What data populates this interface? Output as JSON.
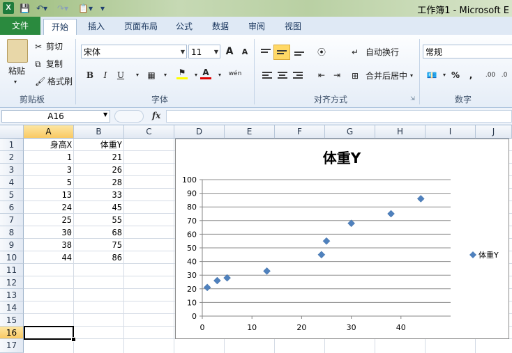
{
  "titlebar": {
    "window_title": "工作簿1 - Microsoft E",
    "app_icon": "X"
  },
  "tabs": {
    "file": "文件",
    "home": "开始",
    "insert": "插入",
    "page_layout": "页面布局",
    "formulas": "公式",
    "data": "数据",
    "review": "审阅",
    "view": "视图"
  },
  "ribbon": {
    "clipboard": {
      "label": "剪贴板",
      "paste": "粘贴",
      "cut": "剪切",
      "copy": "复制",
      "format_painter": "格式刷"
    },
    "font": {
      "label": "字体",
      "font_name": "宋体",
      "font_size": "11",
      "grow": "A",
      "shrink": "A",
      "bold": "B",
      "italic": "I",
      "underline": "U",
      "phonetic": "wén"
    },
    "alignment": {
      "label": "对齐方式",
      "wrap_text": "自动换行",
      "merge_center": "合并后居中"
    },
    "number": {
      "label": "数字",
      "format": "常规",
      "percent": "%",
      "comma": ",",
      "inc_decimal": ".00",
      "dec_decimal": ".0"
    }
  },
  "formula_bar": {
    "name_box": "A16",
    "fx": "fx",
    "value": ""
  },
  "sheet": {
    "columns": [
      "A",
      "B",
      "C",
      "D",
      "E",
      "F",
      "G",
      "H",
      "I",
      "J"
    ],
    "rows": [
      "1",
      "2",
      "3",
      "4",
      "5",
      "6",
      "7",
      "8",
      "9",
      "10",
      "11",
      "12",
      "13",
      "14",
      "15",
      "16",
      "17"
    ],
    "selected_cell": "A16",
    "data": [
      [
        "身高X",
        "体重Y"
      ],
      [
        "1",
        "21"
      ],
      [
        "3",
        "26"
      ],
      [
        "5",
        "28"
      ],
      [
        "13",
        "33"
      ],
      [
        "24",
        "45"
      ],
      [
        "25",
        "55"
      ],
      [
        "30",
        "68"
      ],
      [
        "38",
        "75"
      ],
      [
        "44",
        "86"
      ]
    ]
  },
  "chart_data": {
    "type": "scatter",
    "title": "体重Y",
    "series": [
      {
        "name": "体重Y",
        "x": [
          1,
          3,
          5,
          13,
          24,
          25,
          30,
          38,
          44
        ],
        "y": [
          21,
          26,
          28,
          33,
          45,
          55,
          68,
          75,
          86
        ],
        "color": "#4f81bd"
      }
    ],
    "xlim": [
      0,
      50
    ],
    "ylim": [
      0,
      100
    ],
    "x_ticks": [
      "0",
      "10",
      "20",
      "30",
      "40"
    ],
    "y_ticks": [
      "0",
      "10",
      "20",
      "30",
      "40",
      "50",
      "60",
      "70",
      "80",
      "90",
      "100"
    ],
    "grid": "horizontal",
    "legend": "right"
  }
}
